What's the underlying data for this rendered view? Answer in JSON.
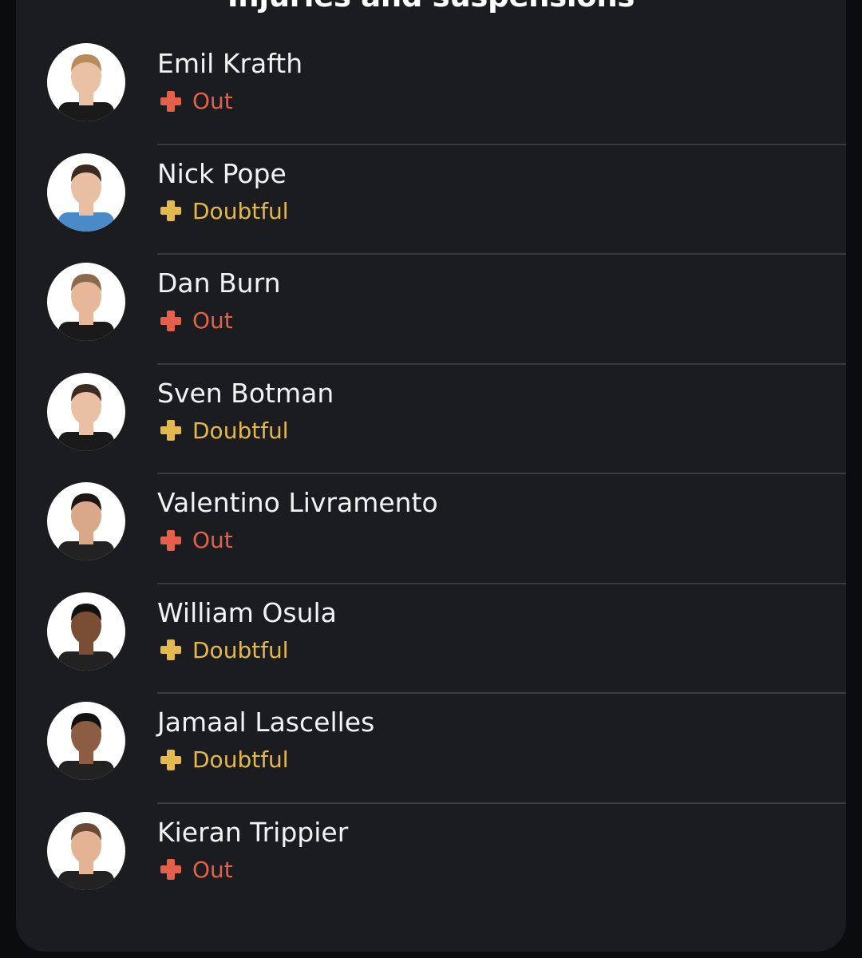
{
  "header": {
    "title": "Injuries and suspensions"
  },
  "colors": {
    "out": "#e5604a",
    "doubtful": "#e3b84c",
    "card": "#1b1c1f"
  },
  "players": [
    {
      "name": "Emil Krafth",
      "status": "Out",
      "status_type": "out",
      "hair": "#b98a5a",
      "skin": "#e9c2a6",
      "shirt": "#1a1a1a"
    },
    {
      "name": "Nick Pope",
      "status": "Doubtful",
      "status_type": "doubtful",
      "hair": "#3a2a20",
      "skin": "#e8bfa3",
      "shirt": "#4a8ac9"
    },
    {
      "name": "Dan Burn",
      "status": "Out",
      "status_type": "out",
      "hair": "#8a6a4a",
      "skin": "#e6b899",
      "shirt": "#1a1a1a"
    },
    {
      "name": "Sven Botman",
      "status": "Doubtful",
      "status_type": "doubtful",
      "hair": "#3b2b22",
      "skin": "#e9c0a4",
      "shirt": "#1a1a1a"
    },
    {
      "name": "Valentino Livramento",
      "status": "Out",
      "status_type": "out",
      "hair": "#1e1612",
      "skin": "#d9a888",
      "shirt": "#222222"
    },
    {
      "name": "William Osula",
      "status": "Doubtful",
      "status_type": "doubtful",
      "hair": "#111111",
      "skin": "#7a4e35",
      "shirt": "#222222"
    },
    {
      "name": "Jamaal Lascelles",
      "status": "Doubtful",
      "status_type": "doubtful",
      "hair": "#111111",
      "skin": "#8c5d42",
      "shirt": "#222222"
    },
    {
      "name": "Kieran Trippier",
      "status": "Out",
      "status_type": "out",
      "hair": "#6b4a33",
      "skin": "#e3b394",
      "shirt": "#222222"
    }
  ]
}
